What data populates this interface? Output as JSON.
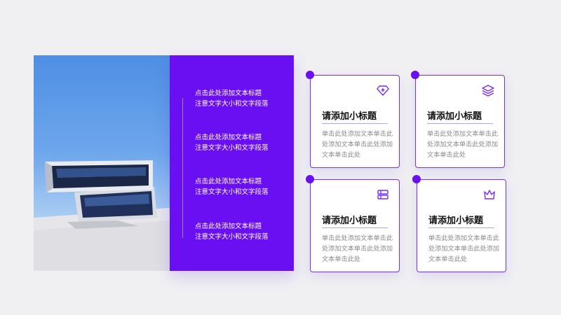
{
  "left_panel": {
    "items": [
      {
        "line1": "点击此处添加文本标题",
        "line2": "注意文字大小和文字段落"
      },
      {
        "line1": "点击此处添加文本标题",
        "line2": "注意文字大小和文字段落"
      },
      {
        "line1": "点击此处添加文本标题",
        "line2": "注意文字大小和文字段落"
      },
      {
        "line1": "点击此处添加文本标题",
        "line2": "注意文字大小和文字段落"
      }
    ]
  },
  "cards": [
    {
      "title": "请添加小标题",
      "body": "单击此处添加文本单击此处添加文本单击此处添加文本单击此处",
      "icon": "diamond-plus-icon"
    },
    {
      "title": "请添加小标题",
      "body": "单击此处添加文本单击此处添加文本单击此处添加文本单击此处",
      "icon": "layers-icon"
    },
    {
      "title": "请添加小标题",
      "body": "单击此处添加文本单击此处添加文本单击此处添加文本单击此处",
      "icon": "books-icon"
    },
    {
      "title": "请添加小标题",
      "body": "单击此处添加文本单击此处添加文本单击此处添加文本单击此处",
      "icon": "crown-icon"
    }
  ],
  "colors": {
    "accent": "#6a0ff2",
    "card_border": "#7b2cf0",
    "background": "#f0f0f3"
  }
}
